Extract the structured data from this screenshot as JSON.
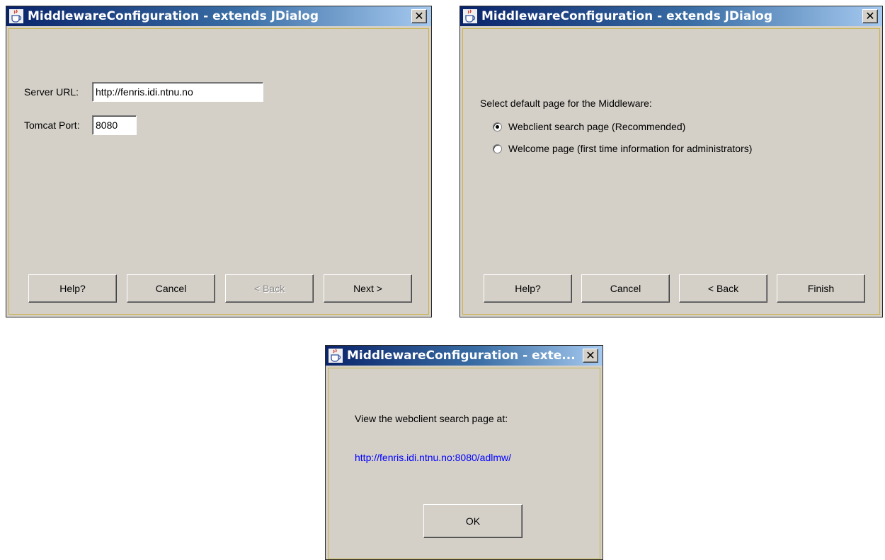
{
  "dialogs": [
    {
      "title": "MiddlewareConfiguration - extends JDialog",
      "server_url_label": "Server URL:",
      "server_url_value": "http://fenris.idi.ntnu.no",
      "tomcat_port_label": "Tomcat Port:",
      "tomcat_port_value": "8080",
      "buttons": {
        "help": "Help?",
        "cancel": "Cancel",
        "back": "< Back",
        "next": "Next >"
      }
    },
    {
      "title": "MiddlewareConfiguration - extends JDialog",
      "prompt": "Select default page for the Middleware:",
      "options": [
        {
          "label": "Webclient search page (Recommended)",
          "checked": true
        },
        {
          "label": "Welcome page (first time information for administrators)",
          "checked": false
        }
      ],
      "buttons": {
        "help": "Help?",
        "cancel": "Cancel",
        "back": "< Back",
        "finish": "Finish"
      }
    },
    {
      "title": "MiddlewareConfiguration - exte...",
      "message": "View the webclient search page at:",
      "link": "http://fenris.idi.ntnu.no:8080/adlmw/",
      "buttons": {
        "ok": "OK"
      }
    }
  ],
  "icons": {
    "app": "java-cup-icon",
    "close": "close-icon"
  },
  "colors": {
    "dialog_bg": "#d4d0c8",
    "title_start": "#0a246a",
    "title_end": "#a6caf0",
    "link": "#0000ff"
  }
}
